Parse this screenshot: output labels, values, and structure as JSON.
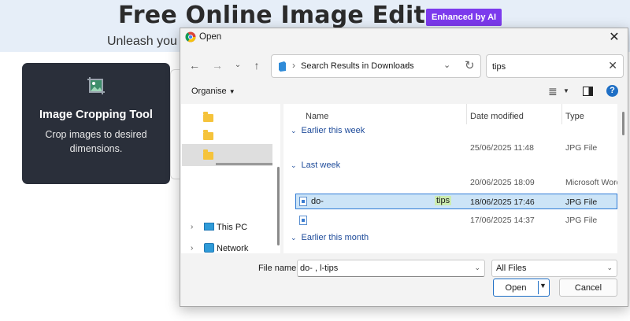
{
  "page": {
    "title": "Free Online Image Editor",
    "badge": "Enhanced by AI",
    "subtitle": "Unleash you",
    "tool_card": {
      "title": "Image Cropping Tool",
      "description": "Crop images to desired dimensions."
    }
  },
  "dialog": {
    "title": "Open",
    "address": {
      "path": "Search Results in Downloads"
    },
    "search": {
      "value": "tips"
    },
    "toolbar": {
      "organise": "Organise"
    },
    "nav_pane": {
      "this_pc": "This PC",
      "network": "Network"
    },
    "columns": {
      "name": "Name",
      "date_modified": "Date modified",
      "type": "Type"
    },
    "groups": [
      {
        "label": "Earlier this week"
      },
      {
        "label": "Last week"
      },
      {
        "label": "Earlier this month"
      }
    ],
    "rows": [
      {
        "name": "",
        "date": "25/06/2025 11:48",
        "type": "JPG File"
      },
      {
        "name": "",
        "date": "20/06/2025 18:09",
        "type": "Microsoft Word"
      },
      {
        "name": "do-",
        "match": "tips",
        "date": "18/06/2025 17:46",
        "type": "JPG File"
      },
      {
        "name": "",
        "date": "17/06/2025 14:37",
        "type": "JPG File"
      }
    ],
    "footer": {
      "file_name_label": "File name:",
      "file_name_value": "do-                    ,               l-tips",
      "file_type": "All Files",
      "open": "Open",
      "cancel": "Cancel"
    }
  }
}
